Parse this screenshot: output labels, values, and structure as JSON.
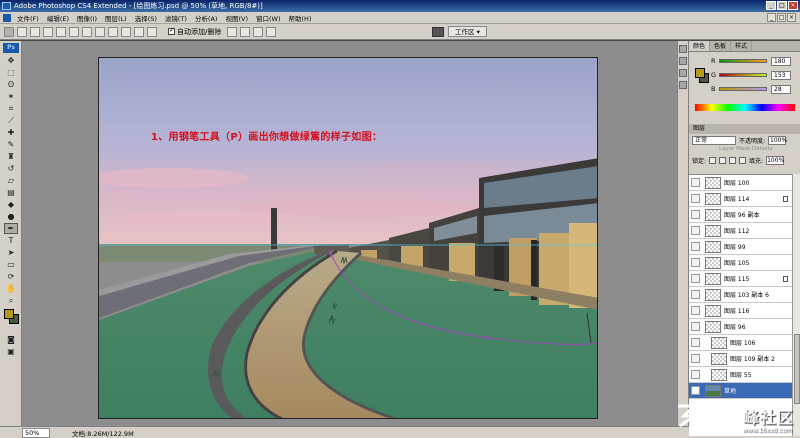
{
  "window": {
    "title": "Adobe Photoshop CS4 Extended - [绘图练习.psd @ 50% (草地, RGB/8#)]",
    "controls": [
      "_",
      "□",
      "×"
    ]
  },
  "menu": {
    "items": [
      "文件(F)",
      "编辑(E)",
      "图像(I)",
      "图层(L)",
      "选择(S)",
      "滤镜(T)",
      "分析(A)",
      "视图(V)",
      "窗口(W)",
      "帮助(H)"
    ]
  },
  "options": {
    "auto_add_delete": "自动添加/删除",
    "workspace": "工作区 ▾"
  },
  "canvas": {
    "instruction": "1、用钢笔工具（P）画出你想做绿篱的样子如图："
  },
  "panels": {
    "color_tabs": [
      "颜色",
      "色板",
      "样式"
    ],
    "color": {
      "R": "180",
      "G": "153",
      "B": "28",
      "fg": "#b4991c",
      "bg": "#4a5a3a"
    },
    "layers_tab": "图层",
    "blend_mode": "正常",
    "opacity_label": "不透明度:",
    "opacity": "100%",
    "mask_density": "Layer Mask Density",
    "lock_label": "锁定:",
    "fill_label": "填充:",
    "fill": "100%",
    "layers": [
      {
        "name": "图层 100",
        "locked": false,
        "selected": false,
        "indent": false
      },
      {
        "name": "图层 114",
        "locked": true,
        "selected": false,
        "indent": false
      },
      {
        "name": "图层 96 副本",
        "locked": false,
        "selected": false,
        "indent": false
      },
      {
        "name": "图层 112",
        "locked": false,
        "selected": false,
        "indent": false
      },
      {
        "name": "图层 99",
        "locked": false,
        "selected": false,
        "indent": false
      },
      {
        "name": "图层 105",
        "locked": false,
        "selected": false,
        "indent": false
      },
      {
        "name": "图层 115",
        "locked": true,
        "selected": false,
        "indent": false
      },
      {
        "name": "图层 103 副本 6",
        "locked": false,
        "selected": false,
        "indent": false
      },
      {
        "name": "图层 116",
        "locked": false,
        "selected": false,
        "indent": false
      },
      {
        "name": "图层 96",
        "locked": false,
        "selected": false,
        "indent": false
      },
      {
        "name": "图层 106",
        "locked": false,
        "selected": false,
        "indent": true
      },
      {
        "name": "图层 109 副本 2",
        "locked": false,
        "selected": false,
        "indent": true
      },
      {
        "name": "图层 55",
        "locked": false,
        "selected": false,
        "indent": true
      },
      {
        "name": "草地",
        "locked": false,
        "selected": true,
        "indent": false
      }
    ]
  },
  "status": {
    "zoom": "50%",
    "doc": "文档:8.26M/122.9M"
  },
  "watermark": {
    "text": "峰社区",
    "url": "www.16xx8.com"
  }
}
